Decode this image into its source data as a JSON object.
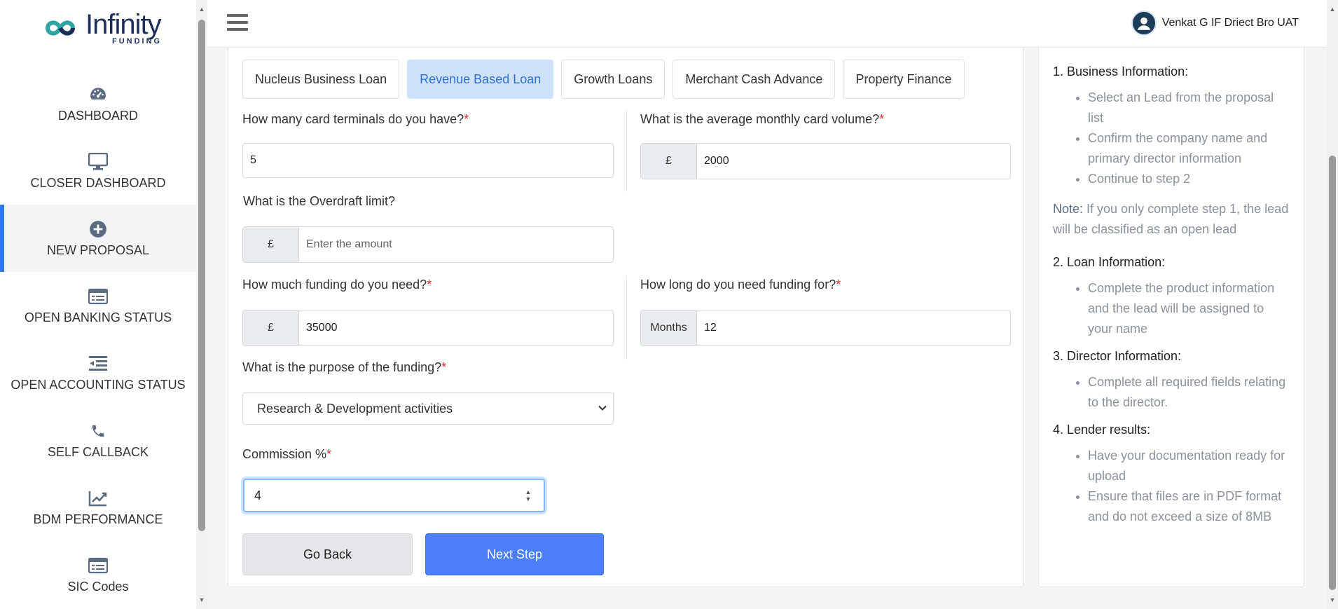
{
  "brand": {
    "name": "Infinity",
    "sub": "FUNDING"
  },
  "sidebar": {
    "items": [
      {
        "label": "DASHBOARD",
        "icon": "dashboard-gauge-icon"
      },
      {
        "label": "CLOSER DASHBOARD",
        "icon": "monitor-icon"
      },
      {
        "label": "NEW PROPOSAL",
        "icon": "plus-circle-icon",
        "active": true
      },
      {
        "label": "OPEN BANKING STATUS",
        "icon": "card-icon"
      },
      {
        "label": "OPEN ACCOUNTING STATUS",
        "icon": "indent-list-icon"
      },
      {
        "label": "SELF CALLBACK",
        "icon": "phone-icon"
      },
      {
        "label": "BDM PERFORMANCE",
        "icon": "chart-line-icon"
      },
      {
        "label": "SIC Codes",
        "icon": "table-list-icon"
      }
    ]
  },
  "header": {
    "user_name": "Venkat G IF Driect Bro UAT"
  },
  "tabs": [
    {
      "label": "Nucleus Business Loan",
      "active": false
    },
    {
      "label": "Revenue Based Loan",
      "active": true
    },
    {
      "label": "Growth Loans",
      "active": false
    },
    {
      "label": "Merchant Cash Advance",
      "active": false
    },
    {
      "label": "Property Finance",
      "active": false
    }
  ],
  "form": {
    "card_terminals": {
      "label": "How many card terminals do you have?",
      "required": "*",
      "value": "5"
    },
    "monthly_card_volume": {
      "label": "What is the average monthly card volume?",
      "required": "*",
      "currency": "£",
      "value": "2000"
    },
    "overdraft": {
      "label": "What is the Overdraft limit?",
      "currency": "£",
      "placeholder": "Enter the amount"
    },
    "funding_amount": {
      "label": "How much funding do you need?",
      "required": "*",
      "currency": "£",
      "value": "35000"
    },
    "funding_duration": {
      "label": "How long do you need funding for?",
      "required": "*",
      "unit": "Months",
      "value": "12"
    },
    "purpose": {
      "label": "What is the purpose of the funding?",
      "required": "*",
      "selected": "Research & Development activities"
    },
    "commission": {
      "label": "Commission %",
      "required": "*",
      "value": "4"
    },
    "back_label": "Go Back",
    "next_label": "Next Step"
  },
  "help": {
    "sections": [
      {
        "title": "1. Business Information:",
        "items": [
          "Select an Lead from the proposal list",
          "Confirm the company name and primary director information",
          "Continue to step 2"
        ]
      },
      {
        "title": "2. Loan Information:",
        "items": [
          "Complete the product information and the lead will be assigned to your name"
        ]
      },
      {
        "title": "3. Director Information:",
        "items": [
          "Complete all required fields relating to the director."
        ]
      },
      {
        "title": "4. Lender results:",
        "items": [
          "Have your documentation ready for upload",
          "Ensure that files are in PDF format and do not exceed a size of 8MB"
        ]
      }
    ],
    "note_label": "Note:",
    "note_text": " If you only complete step 1, the lead will be classified as an open lead"
  },
  "colors": {
    "accent": "#4b7ffb",
    "active_tab_bg": "#cfe2fb",
    "required": "#e02b2b"
  }
}
